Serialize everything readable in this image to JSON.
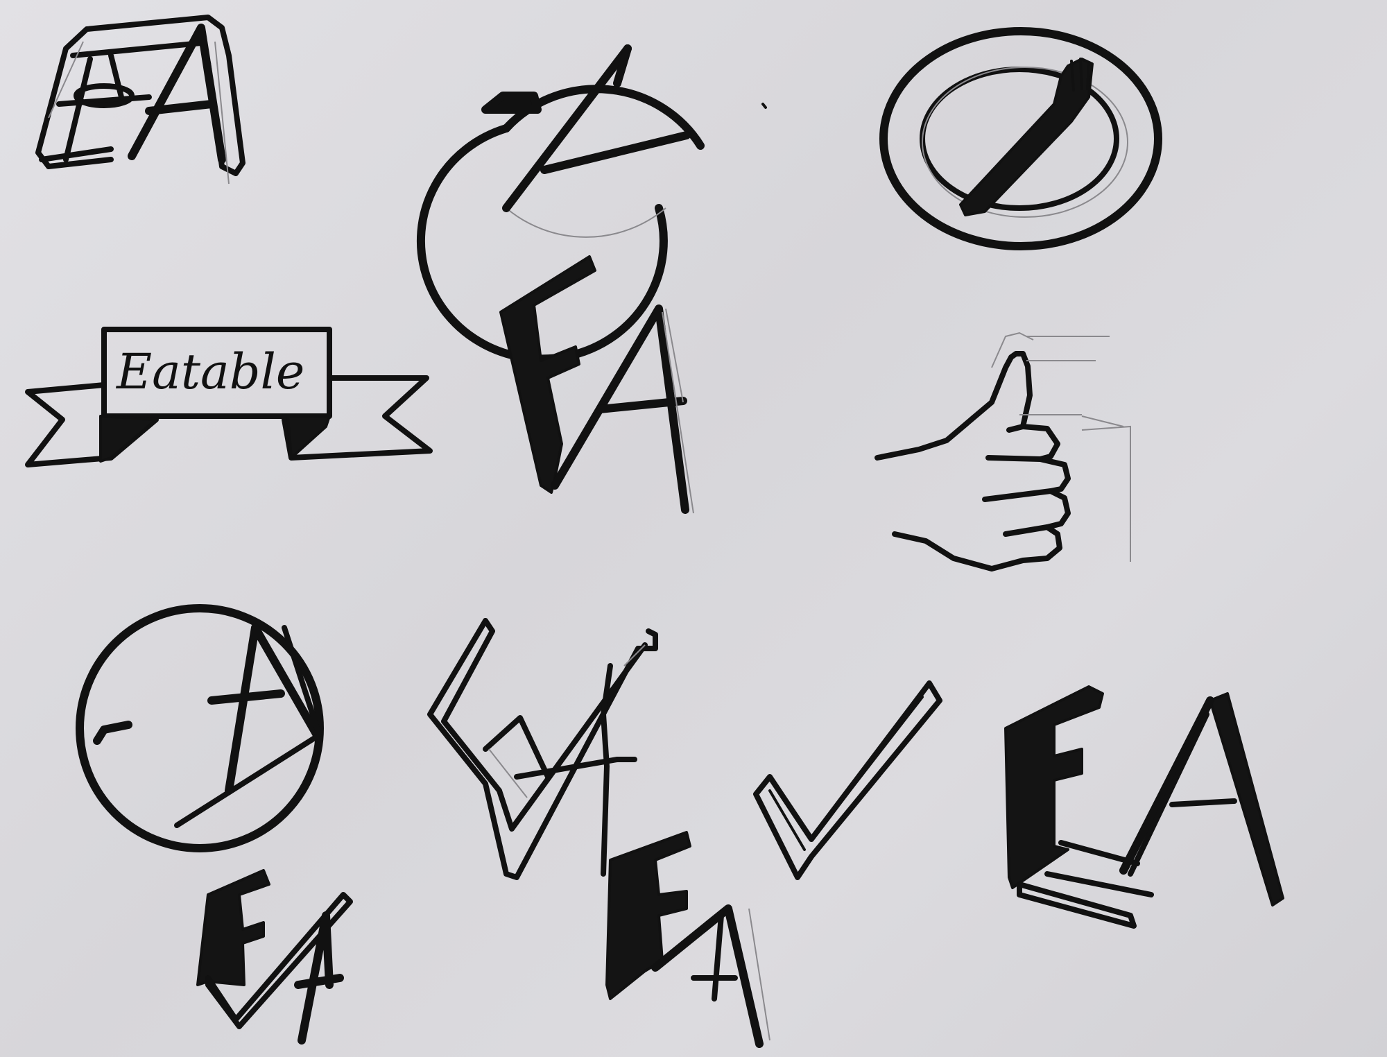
{
  "sheet": {
    "banner_text": "Eatable",
    "sketches": [
      "ea-cylinder-logo-sketch",
      "ea-circle-logo-sketch",
      "fork-plate-logo-sketch",
      "eatable-ribbon-banner-sketch",
      "tall-ea-monogram-sketch",
      "thumbs-up-hand-sketch",
      "ea-circle-logo-sketch-alt",
      "ea-zigzag-logo-sketch",
      "checkmark-logo-sketch",
      "bold-ea-monogram-sketch",
      "small-ea-monogram-sketch",
      "ea-monogram-bottom-sketch"
    ]
  },
  "colors": {
    "paper": "#dcdbdf",
    "ink": "#111111",
    "pencil": "#8a898d"
  }
}
